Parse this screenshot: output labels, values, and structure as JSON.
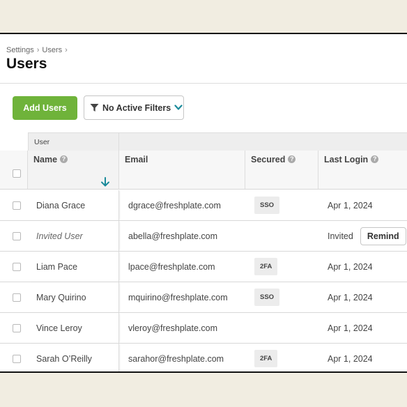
{
  "breadcrumb": [
    "Settings",
    "Users"
  ],
  "page_title": "Users",
  "toolbar": {
    "add_label": "Add Users",
    "filter_label": "No Active Filters",
    "accent": "#6fb33a",
    "chevron_color": "#1a8a9a"
  },
  "table": {
    "group_label": "User",
    "columns": {
      "name": "Name",
      "email": "Email",
      "secured": "Secured",
      "last_login": "Last Login"
    },
    "rows": [
      {
        "name": "Diana Grace",
        "email": "dgrace@freshplate.com",
        "secured": "SSO",
        "last_login": "Apr 1, 2024"
      },
      {
        "name": "Invited User",
        "email": "abella@freshplate.com",
        "secured": "",
        "last_login": "Invited",
        "action": "Remind"
      },
      {
        "name": "Liam Pace",
        "email": "lpace@freshplate.com",
        "secured": "2FA",
        "last_login": "Apr 1, 2024"
      },
      {
        "name": "Mary Quirino",
        "email": "mquirino@freshplate.com",
        "secured": "SSO",
        "last_login": "Apr 1, 2024"
      },
      {
        "name": "Vince Leroy",
        "email": "vleroy@freshplate.com",
        "secured": "",
        "last_login": "Apr 1, 2024"
      },
      {
        "name": "Sarah O’Reilly",
        "email": "sarahor@freshplate.com",
        "secured": "2FA",
        "last_login": "Apr 1, 2024"
      }
    ]
  }
}
